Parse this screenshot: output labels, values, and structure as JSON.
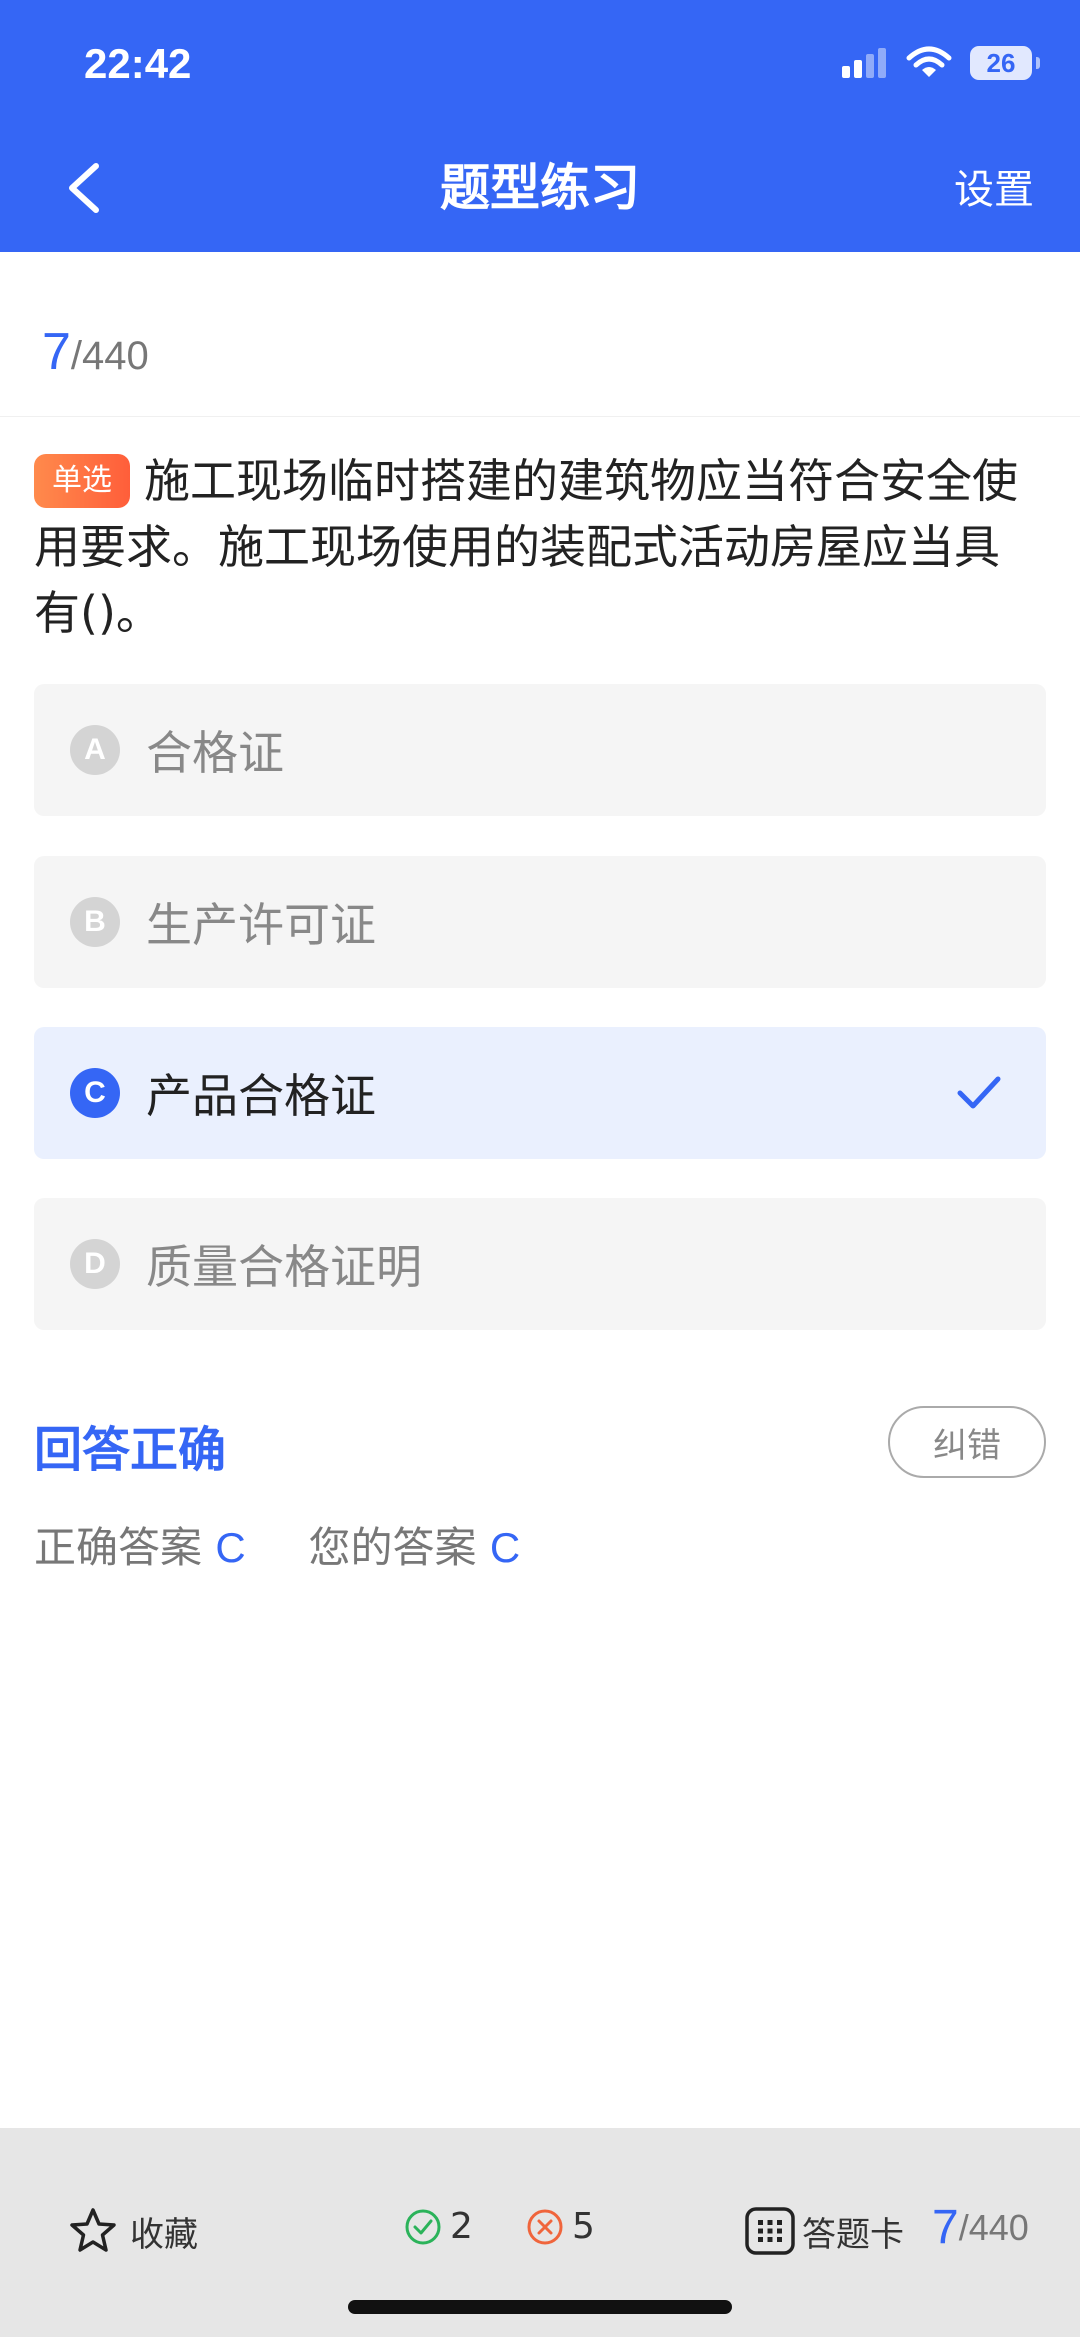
{
  "status": {
    "time": "22:42",
    "battery": "26"
  },
  "nav": {
    "title": "题型练习",
    "settings": "设置"
  },
  "progress": {
    "current": "7",
    "total": "/440"
  },
  "question": {
    "type_tag": "单选",
    "text": "施工现场临时搭建的建筑物应当符合安全使用要求。施工现场使用的装配式活动房屋应当具有()。"
  },
  "options": [
    {
      "letter": "A",
      "text": "合格证"
    },
    {
      "letter": "B",
      "text": "生产许可证"
    },
    {
      "letter": "C",
      "text": "产品合格证"
    },
    {
      "letter": "D",
      "text": "质量合格证明"
    }
  ],
  "selected_option": "C",
  "result": {
    "status": "回答正确",
    "report_button": "纠错",
    "correct_label": "正确答案",
    "correct_value": "C",
    "your_label": "您的答案",
    "your_value": "C"
  },
  "bottom": {
    "favorite": "收藏",
    "correct_count": "2",
    "wrong_count": "5",
    "answer_card": "答题卡",
    "progress_current": "7",
    "progress_total": "/440"
  },
  "colors": {
    "primary": "#3566F5",
    "tag": "#FF6B3D",
    "correct": "#2BB35A",
    "wrong": "#F0653C"
  },
  "icons": [
    "back-icon",
    "signal-icon",
    "wifi-icon",
    "battery-icon",
    "check-icon",
    "star-icon",
    "correct-circle-icon",
    "wrong-circle-icon",
    "grid-icon"
  ]
}
